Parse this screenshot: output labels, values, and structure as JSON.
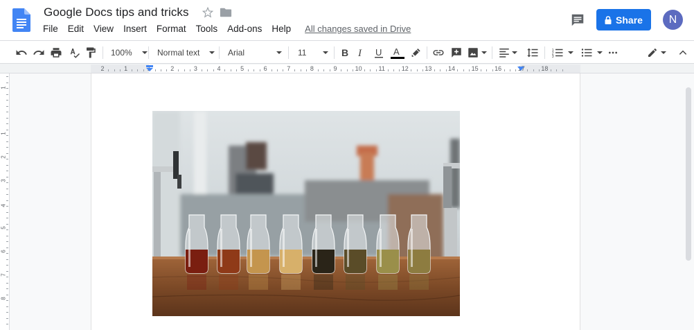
{
  "document": {
    "title": "Google Docs tips and tricks",
    "save_status": "All changes saved in Drive"
  },
  "menu": [
    "File",
    "Edit",
    "View",
    "Insert",
    "Format",
    "Tools",
    "Add-ons",
    "Help"
  ],
  "share": {
    "label": "Share"
  },
  "user": {
    "initial": "N"
  },
  "toolbar": {
    "zoom": "100%",
    "style": "Normal text",
    "font": "Arial",
    "size": "11"
  },
  "ruler": {
    "labels": [
      "2",
      "1",
      "1",
      "2",
      "3",
      "4",
      "5",
      "6",
      "7",
      "8",
      "9",
      "10",
      "11",
      "12",
      "13",
      "14",
      "15",
      "16",
      "17",
      "18"
    ]
  },
  "vruler": {
    "labels": [
      "1",
      "1",
      "2",
      "3",
      "4",
      "5",
      "6",
      "7",
      "8"
    ]
  },
  "colors": {
    "accent": "#1a73e8",
    "avatar": "#5c6bc0",
    "docs_blue": "#4285f4"
  }
}
